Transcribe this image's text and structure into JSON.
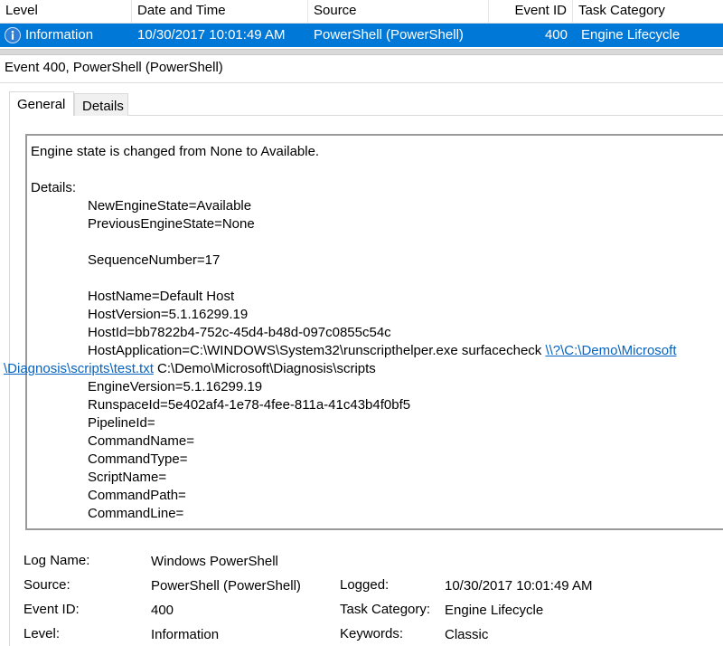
{
  "list": {
    "columns": [
      "Level",
      "Date and Time",
      "Source",
      "Event ID",
      "Task Category"
    ],
    "selected_row": {
      "level": "Information",
      "date_time": "10/30/2017 10:01:49 AM",
      "source": "PowerShell (PowerShell)",
      "event_id": "400",
      "task_category": "Engine Lifecycle",
      "level_icon": "info-icon"
    },
    "selection_color": "#0078d7"
  },
  "detail": {
    "title": "Event 400, PowerShell (PowerShell)",
    "tabs": [
      "General",
      "Details"
    ],
    "active_tab": "General",
    "description": {
      "summary": "Engine state is changed from None to Available.",
      "details_label": "Details:",
      "lines": [
        "NewEngineState=Available",
        "PreviousEngineState=None",
        "SequenceNumber=17",
        "HostName=Default Host",
        "HostVersion=5.1.16299.19",
        "HostId=bb7822b4-752c-45d4-b48d-097c0855c54c",
        "HostApplication=C:\\WINDOWS\\System32\\runscripthelper.exe surfacecheck ",
        "EngineVersion=5.1.16299.19",
        "RunspaceId=5e402af4-1e78-4fee-811a-41c43b4f0bf5",
        "PipelineId=",
        "CommandName=",
        "CommandType=",
        "ScriptName=",
        "CommandPath=",
        "CommandLine="
      ],
      "link_part1": "\\\\?\\C:\\Demo\\Microsoft",
      "link_part2": "\\Diagnosis\\scripts\\test.txt",
      "after_link": " C:\\Demo\\Microsoft\\Diagnosis\\scripts"
    },
    "properties": {
      "log_name_label": "Log Name:",
      "log_name": "Windows PowerShell",
      "source_label": "Source:",
      "source": "PowerShell (PowerShell)",
      "logged_label": "Logged:",
      "logged": "10/30/2017 10:01:49 AM",
      "event_id_label": "Event ID:",
      "event_id": "400",
      "task_category_label": "Task Category:",
      "task_category": "Engine Lifecycle",
      "level_label": "Level:",
      "level": "Information",
      "keywords_label": "Keywords:",
      "keywords": "Classic"
    }
  }
}
